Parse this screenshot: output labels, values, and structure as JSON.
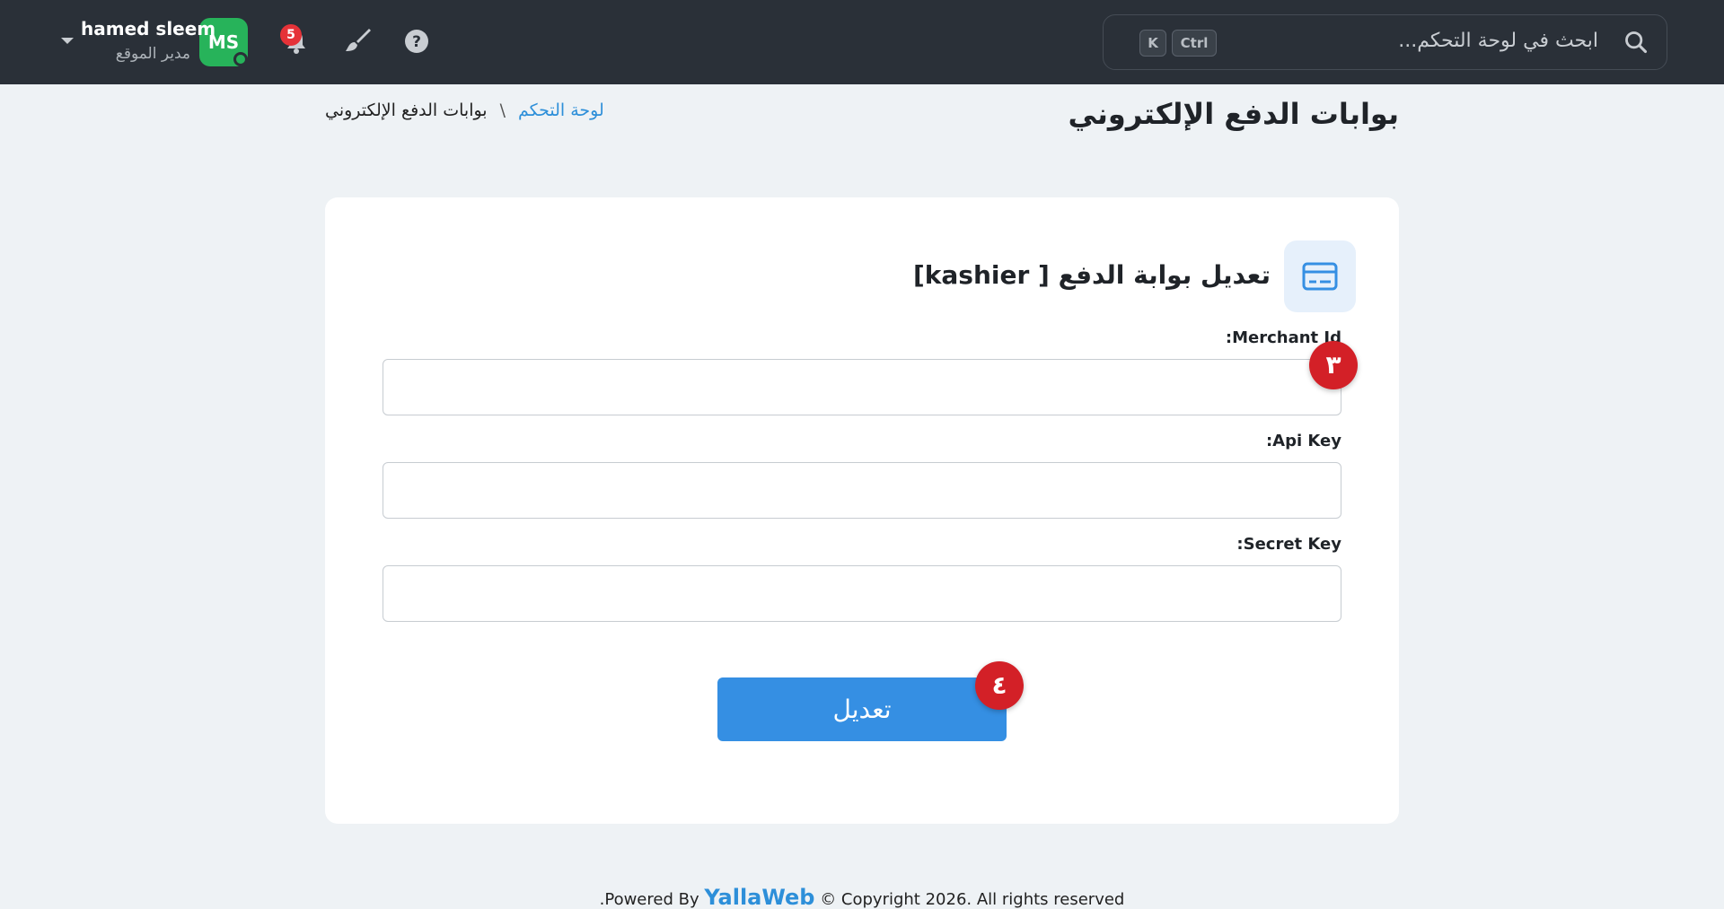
{
  "header": {
    "search_placeholder": "ابحث في لوحة التحكم...",
    "kbd_ctrl": "Ctrl",
    "kbd_k": "K",
    "notification_count": "5",
    "user": {
      "initials": "MS",
      "name": "hamed sleem",
      "role": "مدير الموقع"
    }
  },
  "page": {
    "title": "بوابات الدفع الإلكتروني",
    "breadcrumb": {
      "home": "لوحة التحكم",
      "separator": "\\",
      "current": "بوابات الدفع الإلكتروني"
    }
  },
  "form": {
    "title": "تعديل بوابة الدفع [ kashier]",
    "fields": [
      {
        "label": ":Merchant Id",
        "value": ""
      },
      {
        "label": ":Api Key",
        "value": ""
      },
      {
        "label": ":Secret Key",
        "value": ""
      }
    ],
    "submit_label": "تعديل",
    "step_badges": [
      "٣",
      "٤"
    ]
  },
  "footer": {
    "prefix": ".Powered By",
    "brand": "YallaWeb",
    "suffix": "© Copyright 2026. All rights reserved"
  },
  "colors": {
    "topbar": "#2a3038",
    "accent": "#358fe3",
    "avatar": "#27b35a",
    "badge": "#d32027"
  }
}
